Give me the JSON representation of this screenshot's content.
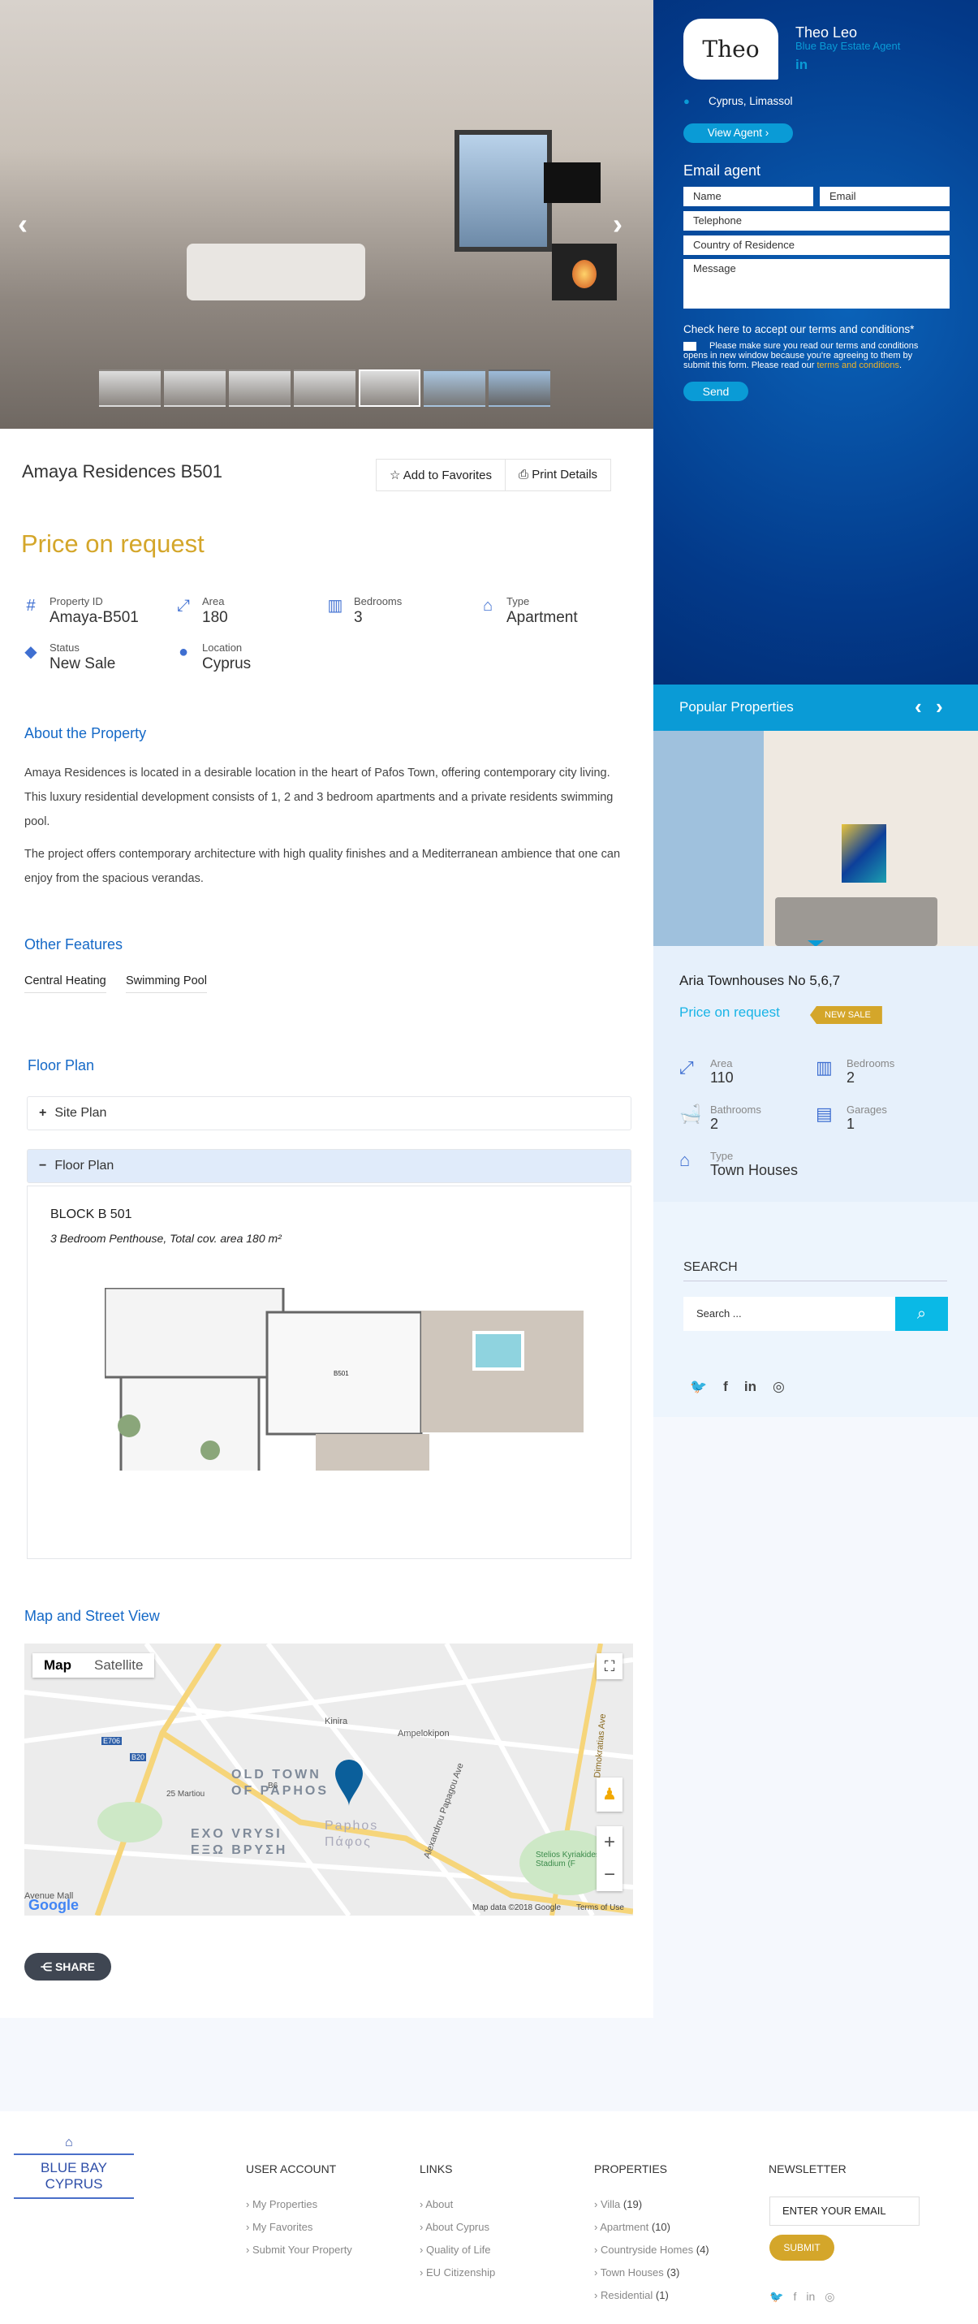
{
  "gallery": {
    "prev_icon": "chevron-left-icon",
    "next_icon": "chevron-right-icon",
    "thumb_count": 7,
    "active_thumb": 5
  },
  "property": {
    "title": "Amaya Residences B501",
    "add_favorites": "Add to Favorites",
    "print_details": "Print Details",
    "price": "Price on request",
    "details": [
      {
        "label": "Property ID",
        "value": "Amaya-B501",
        "icon": "hash-icon"
      },
      {
        "label": "Area",
        "value": "180",
        "icon": "area-icon"
      },
      {
        "label": "Bedrooms",
        "value": "3",
        "icon": "bed-icon"
      },
      {
        "label": "Type",
        "value": "Apartment",
        "icon": "home-icon"
      },
      {
        "label": "Status",
        "value": "New Sale",
        "icon": "tag-icon"
      },
      {
        "label": "Location",
        "value": "Cyprus",
        "icon": "location-pin-icon"
      }
    ]
  },
  "about": {
    "heading": "About the Property",
    "paragraphs": [
      "Amaya Residences is located in a desirable location in the heart of Pafos Town, offering contemporary city living. This luxury residential development consists of 1, 2 and 3 bedroom apartments and a private residents swimming pool.",
      "The project offers contemporary architecture with high quality finishes and a Mediterranean ambience that one can enjoy from the spacious verandas."
    ]
  },
  "features": {
    "heading": "Other Features",
    "items": [
      "Central Heating",
      "Swimming Pool"
    ]
  },
  "floor_plan": {
    "heading": "Floor Plan",
    "accordions": [
      {
        "label": "Site Plan",
        "icon": "+",
        "expanded": false
      },
      {
        "label": "Floor Plan",
        "icon": "−",
        "expanded": true
      }
    ],
    "block_title": "BLOCK B 501",
    "block_subtitle": "3 Bedroom  Penthouse, Total cov. area 180 m²",
    "plan_label": "B501"
  },
  "map": {
    "heading": "Map and Street View",
    "tab_map": "Map",
    "tab_satellite": "Satellite",
    "zoom_in": "+",
    "zoom_out": "−",
    "attribution": "Map data ©2018 Google",
    "terms": "Terms of Use",
    "google": "Google",
    "labels": [
      "OLD TOWN",
      "OF PAPHOS",
      "EXO VRYSI",
      "ΕΞΩ ΒΡΥΣΗ",
      "Paphos",
      "Πάφος",
      "Kinira",
      "Ampelokipon",
      "Alexandrou Papagou Ave",
      "Dimokratias Ave",
      "Stelios Kyriakides Stadium (F",
      "B6",
      "E706",
      "B20",
      "25 Martiou",
      "Avenue Mall"
    ]
  },
  "share": {
    "label": "SHARE"
  },
  "agent": {
    "avatar_text": "Theo",
    "name": "Theo Leo",
    "role": "Blue Bay Estate Agent",
    "linkedin": "in",
    "location": "Cyprus, Limassol",
    "view_agent": "View Agent  ›",
    "email_heading": "Email agent",
    "form": {
      "name": "Name",
      "email": "Email",
      "telephone": "Telephone",
      "country": "Country of Residence",
      "message": "Message"
    },
    "terms_heading": "Check here to accept our terms and conditions*",
    "terms_text": "Please make sure you read our terms and conditions opens in new window because you're agreeing to them by submit this form. Please read our ",
    "terms_link": "terms and conditions",
    "terms_end": ".",
    "send": "Send"
  },
  "popular": {
    "heading": "Popular Properties",
    "title": "Aria Townhouses No 5,6,7",
    "price": "Price on request",
    "badge": "NEW SALE",
    "details": [
      {
        "label": "Area",
        "value": "110"
      },
      {
        "label": "Bedrooms",
        "value": "2"
      },
      {
        "label": "Bathrooms",
        "value": "2"
      },
      {
        "label": "Garages",
        "value": "1"
      },
      {
        "label": "Type",
        "value": "Town Houses"
      }
    ]
  },
  "search": {
    "heading": "SEARCH",
    "placeholder": "Search ..."
  },
  "footer": {
    "logo": "BLUE BAY CYPRUS",
    "user_account": {
      "heading": "USER ACCOUNT",
      "items": [
        "My Properties",
        "My Favorites",
        "Submit Your Property"
      ]
    },
    "links": {
      "heading": "LINKS",
      "items": [
        "About",
        "About Cyprus",
        "Quality of Life",
        "EU Citizenship"
      ]
    },
    "properties": {
      "heading": "PROPERTIES",
      "items": [
        {
          "name": "Villa",
          "count": "(19)"
        },
        {
          "name": "Apartment",
          "count": "(10)"
        },
        {
          "name": "Countryside Homes",
          "count": "(4)"
        },
        {
          "name": "Town Houses",
          "count": "(3)"
        },
        {
          "name": "Residential",
          "count": "(1)"
        }
      ]
    },
    "newsletter": {
      "heading": "NEWSLETTER",
      "placeholder": "ENTER YOUR EMAIL",
      "submit": "SUBMIT"
    }
  },
  "colors": {
    "accent": "#0a9bd6",
    "price_gold": "#d4a62a",
    "heading_blue": "#1569c7",
    "agent_bg": "#033a8a"
  }
}
